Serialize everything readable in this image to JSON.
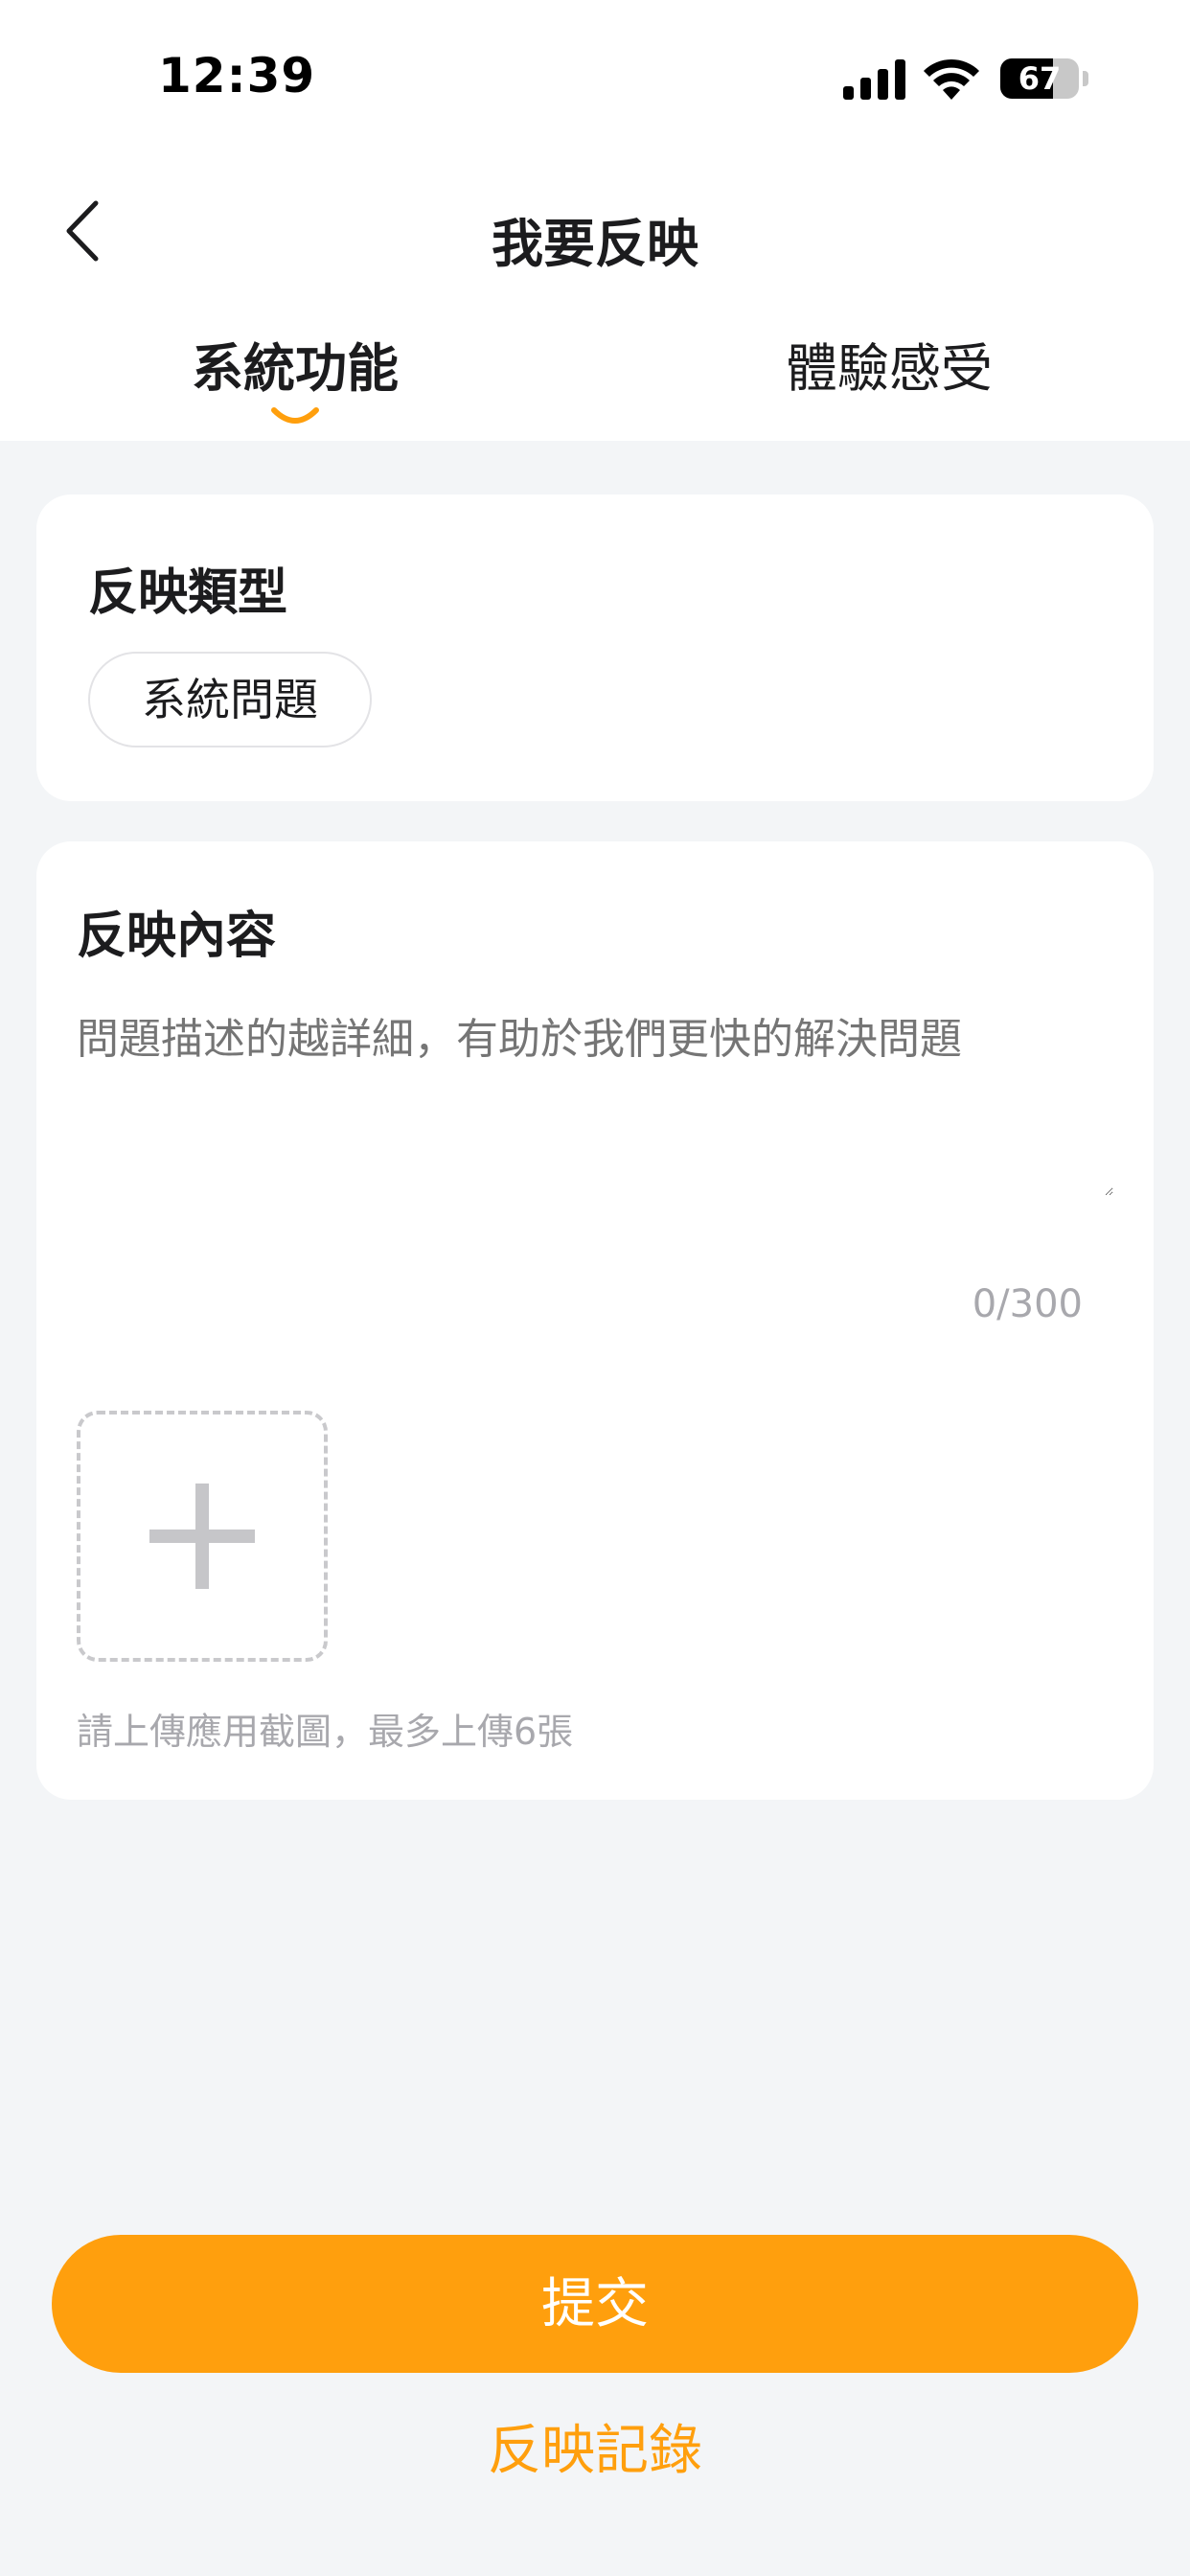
{
  "status_bar": {
    "time": "12:39",
    "battery_level": "67",
    "battery_fraction": 0.67
  },
  "nav": {
    "title": "我要反映"
  },
  "tabs": [
    {
      "label": "系統功能",
      "active": true
    },
    {
      "label": "體驗感受",
      "active": false
    }
  ],
  "feedback_type": {
    "title": "反映類型",
    "selected": "系統問題"
  },
  "feedback_content": {
    "title": "反映內容",
    "placeholder": "問題描述的越詳細，有助於我們更快的解決問題",
    "value": "",
    "counter": "0/300",
    "upload_hint": "請上傳應用截圖，最多上傳6張"
  },
  "actions": {
    "submit_label": "提交",
    "records_label": "反映記錄"
  },
  "colors": {
    "accent": "#ff9f0d",
    "background": "#f3f5f7",
    "card": "#ffffff"
  }
}
